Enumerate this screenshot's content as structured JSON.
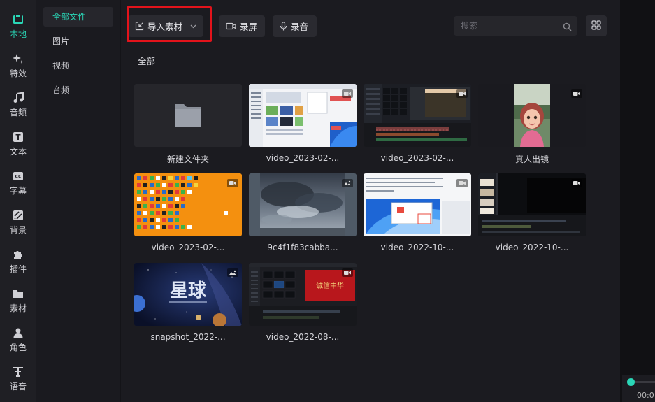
{
  "rail": {
    "items": [
      {
        "label": "本地",
        "icon": "local-folder-icon",
        "active": true
      },
      {
        "label": "特效",
        "icon": "effects-sparkle-icon"
      },
      {
        "label": "音频",
        "icon": "music-note-icon"
      },
      {
        "label": "文本",
        "icon": "text-t-icon"
      },
      {
        "label": "字幕",
        "icon": "subtitle-cc-icon"
      },
      {
        "label": "背景",
        "icon": "background-pattern-icon"
      },
      {
        "label": "插件",
        "icon": "plugin-puzzle-icon"
      },
      {
        "label": "素材",
        "icon": "material-folder-icon"
      },
      {
        "label": "角色",
        "icon": "character-person-icon"
      },
      {
        "label": "语音",
        "icon": "voice-tts-icon"
      }
    ]
  },
  "subnav": {
    "items": [
      {
        "label": "全部文件",
        "active": true
      },
      {
        "label": "图片"
      },
      {
        "label": "视频"
      },
      {
        "label": "音频"
      }
    ]
  },
  "toolbar": {
    "import_label": "导入素材",
    "record_screen_label": "录屏",
    "record_audio_label": "录音",
    "search_placeholder": "搜索"
  },
  "section_label": "全部",
  "media": [
    {
      "name": "新建文件夹",
      "type": "folder"
    },
    {
      "name": "video_2023-02-...",
      "type": "video"
    },
    {
      "name": "video_2023-02-...",
      "type": "video"
    },
    {
      "name": "真人出镜",
      "type": "video"
    },
    {
      "name": "video_2023-02-...",
      "type": "video"
    },
    {
      "name": "9c4f1f83cabba...",
      "type": "image"
    },
    {
      "name": "video_2022-10-...",
      "type": "video"
    },
    {
      "name": "video_2022-10-...",
      "type": "video"
    },
    {
      "name": "snapshot_2022-...",
      "type": "image"
    },
    {
      "name": "video_2022-08-...",
      "type": "video"
    }
  ],
  "thumb_text": {
    "planet_title": "星球",
    "red_banner_text": "诚信中华"
  },
  "timeline": {
    "time": "00:0"
  },
  "colors": {
    "accent": "#2ad7b7",
    "highlight": "#e3131b",
    "panel": "#1b1b20"
  }
}
